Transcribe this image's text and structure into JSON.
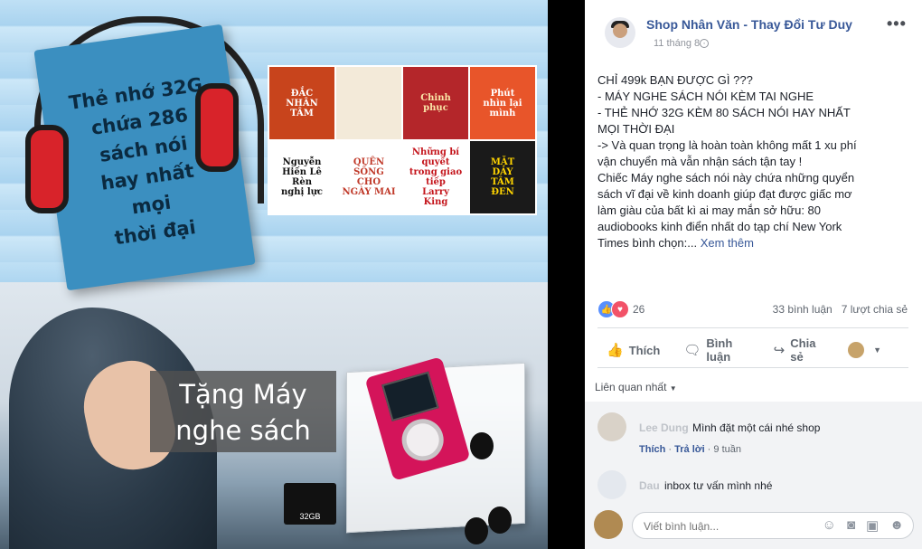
{
  "image": {
    "book_text": "Thẻ nhớ 32G\nchứa 286\nsách nói\nhay nhất\nmọi\nthời đại",
    "covers": [
      {
        "text": "ĐẮC\nNHÂN\nTÂM",
        "bg": "#c8441c",
        "fg": "#ffffff"
      },
      {
        "text": "",
        "bg": "#f3ead9",
        "fg": "#444444"
      },
      {
        "text": "Chinh\nphục",
        "bg": "#b4262a",
        "fg": "#fbe6a8"
      },
      {
        "text": "Phút\nnhìn lại\nmình",
        "bg": "#e8552a",
        "fg": "#ffffff"
      },
      {
        "text": "Nguyễn\nHiến Lê\nRèn\nnghị lực",
        "bg": "#ffffff",
        "fg": "#111111"
      },
      {
        "text": "QUÊN\nSỐNG\nCHO\nNGÀY MAI",
        "bg": "#ffffff",
        "fg": "#c03a2a"
      },
      {
        "text": "Những bí quyết\ntrong giao tiếp\nLarry\nKing",
        "bg": "#ffffff",
        "fg": "#c4151c"
      },
      {
        "text": "MẶT\nDÀY\nTÂM\nĐEN",
        "bg": "#1a1a1a",
        "fg": "#ffd400"
      }
    ],
    "promo_text": "Tặng Máy\nnghe sách",
    "card_label": "32GB"
  },
  "post": {
    "page_name": "Shop Nhân Văn - Thay Đổi Tư Duy",
    "date": "11 tháng 8 ·",
    "lines": [
      "CHỈ 499k BẠN ĐƯỢC GÌ ???",
      "- MÁY NGHE SÁCH NÓI KÈM TAI NGHE",
      "- THẺ NHỚ 32G KÈM 80 SÁCH NÓI HAY NHẤT",
      "MỌI THỜI ĐẠI",
      "-> Và quan trọng là hoàn toàn không mất 1 xu phí",
      "vận chuyển mà vẫn nhận sách tận tay !",
      "Chiếc Máy nghe sách nói này chứa những quyển",
      "sách vĩ đại về kinh doanh giúp đạt được giấc mơ",
      "làm giàu của bất kì ai may mắn sở hữu: 80",
      "audiobooks kinh điển nhất do tạp chí New York"
    ],
    "last_line": "Times bình chọn:...",
    "see_more": "Xem thêm",
    "reaction_count": "26",
    "comment_count": "33 bình luận",
    "share_count": "7 lượt chia sẻ",
    "actions": {
      "like": "Thích",
      "comment": "Bình luận",
      "share": "Chia sẻ"
    },
    "sort_label": "Liên quan nhất"
  },
  "comments": [
    {
      "name": "Lee Dung",
      "text": "Mình đặt một cái nhé shop",
      "like": "Thích",
      "reply": "Trả lời",
      "time": "9 tuần"
    },
    {
      "name": "Dau",
      "text": "inbox tư vấn mình nhé"
    }
  ],
  "composer": {
    "placeholder": "Viết bình luận..."
  }
}
